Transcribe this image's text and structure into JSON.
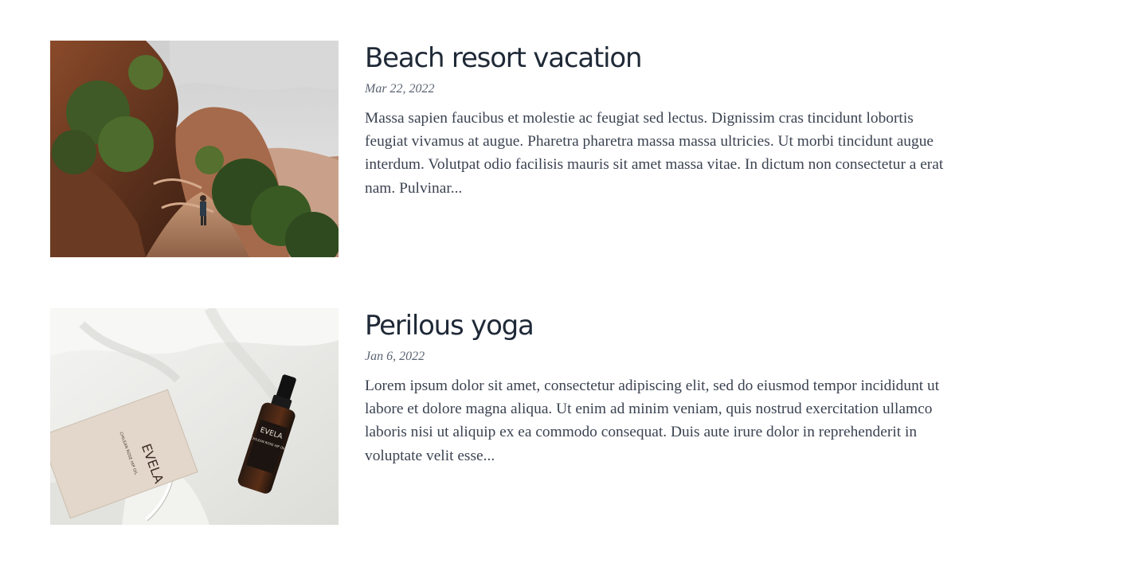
{
  "posts": [
    {
      "title": "Beach resort vacation",
      "date": "Mar 22, 2022",
      "excerpt": "Massa sapien faucibus et molestie ac feugiat sed lectus. Dignissim cras tincidunt lobortis feugiat vivamus at augue. Pharetra pharetra massa massa ultricies. Ut morbi tincidunt augue interdum. Volutpat odio facilisis mauris sit amet massa vitae. In dictum non consectetur a erat nam. Pulvinar...",
      "image": "canyon-hiker-photo"
    },
    {
      "title": "Perilous yoga",
      "date": "Jan 6, 2022",
      "excerpt": "Lorem ipsum dolor sit amet, consectetur adipiscing elit, sed do eiusmod tempor incididunt ut labore et dolore magna aliqua. Ut enim ad minim veniam, quis nostrud exercitation ullamco laboris nisi ut aliquip ex ea commodo consequat. Duis aute irure dolor in reprehenderit in voluptate velit esse...",
      "image": "serum-bottle-photo",
      "product_box_text": "EVELA",
      "product_box_subtext": "CHILEAN ROSE HIP OIL",
      "bottle_label": "EVELA",
      "bottle_subtext": "CHILEAN ROSE HIP OIL"
    }
  ]
}
